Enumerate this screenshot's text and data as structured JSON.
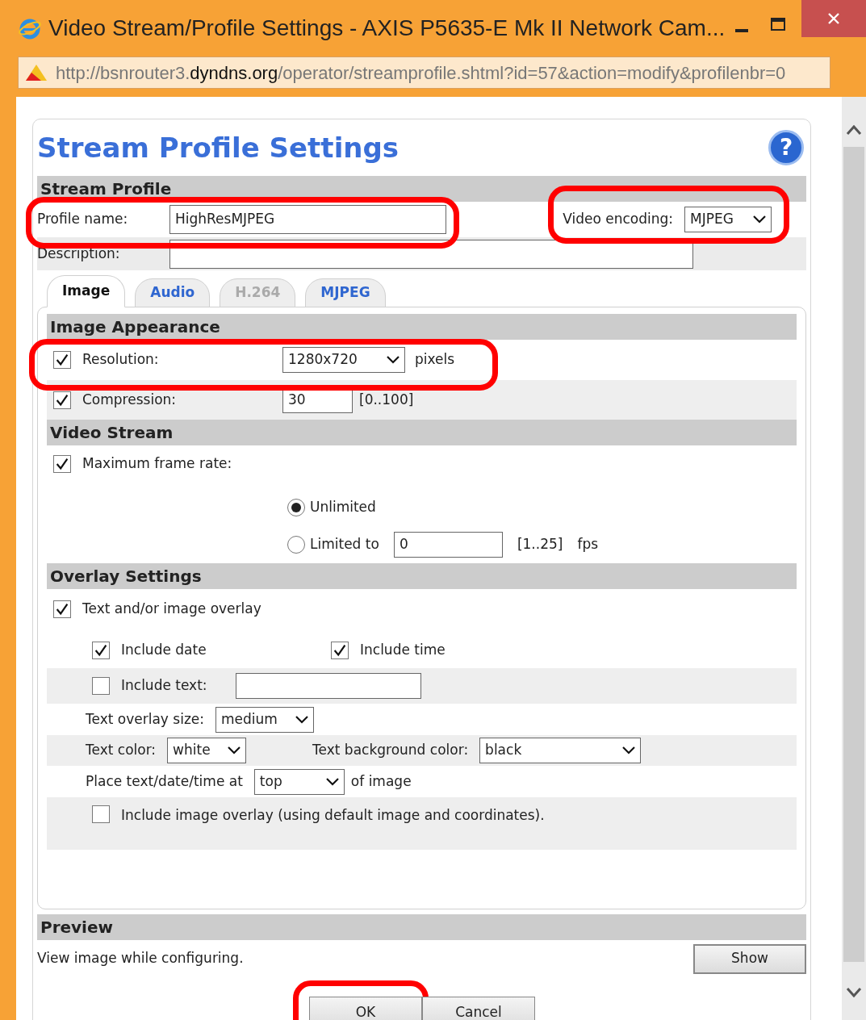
{
  "window": {
    "title": "Video Stream/Profile Settings - AXIS P5635-E Mk II Network Cam...",
    "url": {
      "prefix": "http://bsnrouter3.",
      "domain": "dyndns.org",
      "path": "/operator/streamprofile.shtml?id=57&action=modify&profilenbr=0"
    }
  },
  "page_title": "Stream Profile Settings",
  "help_button": "?",
  "stream_profile": {
    "heading": "Stream Profile",
    "profile_name": {
      "label": "Profile name:",
      "value": "HighResMJPEG",
      "highlight": true
    },
    "video_encoding": {
      "label": "Video encoding:",
      "value": "MJPEG",
      "highlight": true
    },
    "description": {
      "label": "Description:"
    }
  },
  "tabs": [
    {
      "label": "Image",
      "selected": true,
      "disabled": false
    },
    {
      "label": "Audio",
      "selected": false,
      "disabled": false
    },
    {
      "label": "H.264",
      "selected": false,
      "disabled": true
    },
    {
      "label": "MJPEG",
      "selected": false,
      "disabled": false
    }
  ],
  "image_appearance": {
    "heading": "Image Appearance",
    "resolution": {
      "label": "Resolution:",
      "checked": true,
      "value": "1280x720",
      "unit": "pixels",
      "highlight": true
    },
    "compression": {
      "label": "Compression:",
      "checked": true,
      "value": "30",
      "range": "[0..100]"
    }
  },
  "video_stream": {
    "heading": "Video Stream",
    "max_frame_rate": {
      "label": "Maximum frame rate:",
      "checked": true
    },
    "options": [
      {
        "kind": "plain",
        "label": "Unlimited",
        "selected": true
      },
      {
        "kind": "limit",
        "label": "Limited to",
        "selected": false,
        "value": "0",
        "range": "[1..25]",
        "unit": "fps"
      }
    ]
  },
  "overlay": {
    "heading": "Overlay Settings",
    "text_overlay": {
      "label": "Text and/or image overlay",
      "checked": true
    },
    "include_date": {
      "label": "Include date",
      "checked": true
    },
    "include_time": {
      "label": "Include time",
      "checked": true
    },
    "include_text": {
      "label": "Include text:",
      "checked": false
    },
    "size": {
      "label": "Text overlay size:",
      "value": "medium"
    },
    "text_color": {
      "label": "Text color:",
      "value": "white"
    },
    "background_color": {
      "label": "Text background color:",
      "value": "black"
    },
    "place": {
      "label": "Place text/date/time at",
      "value": "top",
      "suffix": "of image"
    },
    "image_overlay": {
      "label": "Include image overlay (using default image and coordinates).",
      "checked": false
    }
  },
  "preview": {
    "heading": "Preview",
    "text": "View image while configuring.",
    "button": "Show"
  },
  "buttons": [
    {
      "label": "OK",
      "highlight": true
    },
    {
      "label": "Cancel",
      "highlight": false
    }
  ]
}
